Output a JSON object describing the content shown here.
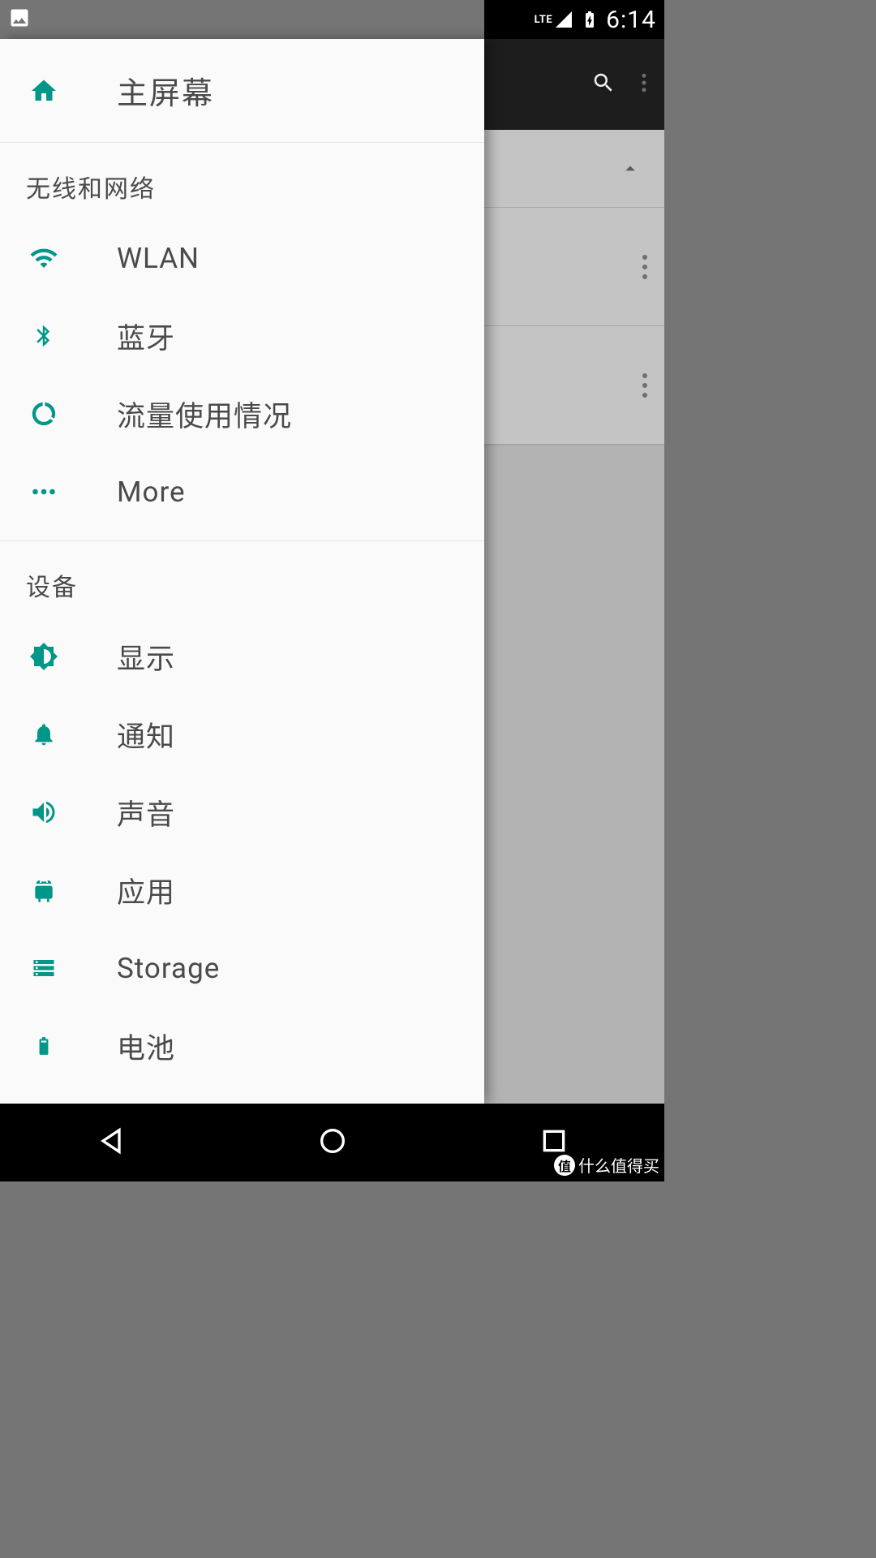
{
  "status_bar": {
    "time": "6:14",
    "lte": "LTE"
  },
  "drawer": {
    "home_label": "主屏幕",
    "sections": [
      {
        "title": "无线和网络",
        "items": [
          {
            "label": "WLAN",
            "icon": "wifi"
          },
          {
            "label": "蓝牙",
            "icon": "bluetooth"
          },
          {
            "label": "流量使用情况",
            "icon": "data"
          },
          {
            "label": "More",
            "icon": "more"
          }
        ]
      },
      {
        "title": "设备",
        "items": [
          {
            "label": "显示",
            "icon": "display"
          },
          {
            "label": "通知",
            "icon": "bell"
          },
          {
            "label": "声音",
            "icon": "sound"
          },
          {
            "label": "应用",
            "icon": "apps"
          },
          {
            "label": "Storage",
            "icon": "storage"
          },
          {
            "label": "电池",
            "icon": "battery"
          }
        ]
      }
    ]
  },
  "watermark_text": "什么值得买"
}
